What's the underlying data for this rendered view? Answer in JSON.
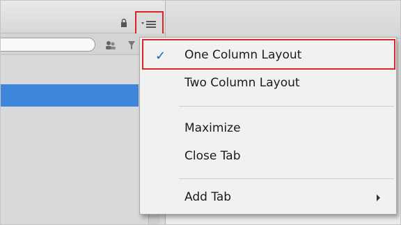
{
  "menu": {
    "items": [
      {
        "label": "One Column Layout",
        "checked": true,
        "highlighted": true
      },
      {
        "label": "Two Column Layout",
        "checked": false
      },
      {
        "label": "Maximize",
        "checked": false
      },
      {
        "label": "Close Tab",
        "checked": false
      },
      {
        "label": "Add Tab",
        "checked": false,
        "submenu": true
      }
    ],
    "check_glyph": "✓"
  },
  "icons": {
    "lock": "lock-icon",
    "panel_menu": "panel-menu-icon",
    "check": "checkmark-icon",
    "submenu": "submenu-arrow-icon"
  },
  "colors": {
    "highlight_border": "#d9242a",
    "selection": "#3f85d9",
    "check": "#1f5fb3"
  }
}
